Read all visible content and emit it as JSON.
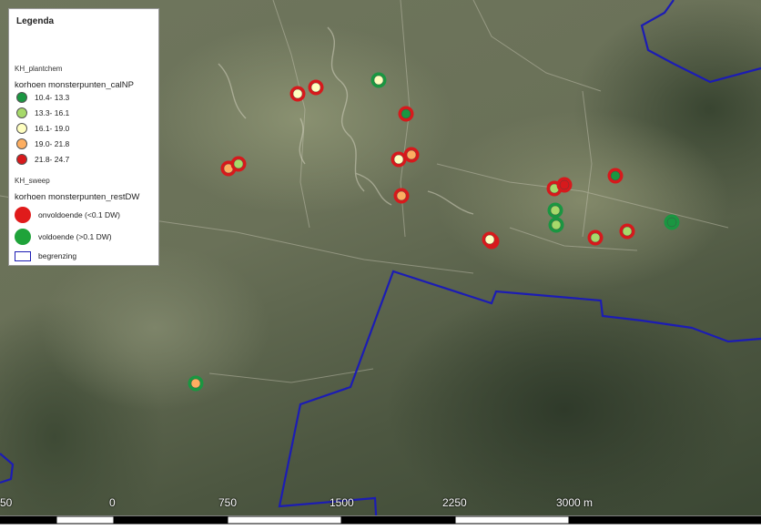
{
  "legend": {
    "title": "Legenda",
    "group_plantchem": "KH_plantchem",
    "layer_calNP": "korhoen monsterpunten_calNP",
    "classes": [
      {
        "label": "10.4- 13.3",
        "color": "#1a9641"
      },
      {
        "label": "13.3- 16.1",
        "color": "#a6d96a"
      },
      {
        "label": "16.1- 19.0",
        "color": "#ffffc0"
      },
      {
        "label": "19.0- 21.8",
        "color": "#fdae61"
      },
      {
        "label": "21.8- 24.7",
        "color": "#d7191c"
      }
    ],
    "group_sweep": "KH_sweep",
    "layer_restDW": "korhoen monsterpunten_restDW",
    "sweep_classes": [
      {
        "label": "onvoldoende (<0.1 DW)",
        "color": "#e01b1b",
        "icon": "red-circle-icon"
      },
      {
        "label": "voldoende (>0.1 DW)",
        "color": "#1fa33a",
        "icon": "green-circle-icon"
      }
    ],
    "boundary": {
      "label": "begrenzing",
      "color": "#1c1cb4",
      "icon": "boundary-box-icon"
    }
  },
  "scale_bar": {
    "labels": [
      "50",
      "0",
      "750",
      "1500",
      "2250",
      "3000 m"
    ]
  },
  "colors": {
    "boundary": "#1c1cb4",
    "ring_red": "#d7191c",
    "ring_green": "#1a9641"
  },
  "sample_points": [
    {
      "id": "p1",
      "calNP_class": 2,
      "restDW": "onvoldoende"
    },
    {
      "id": "p2",
      "calNP_class": 2,
      "restDW": "onvoldoende"
    },
    {
      "id": "p3",
      "calNP_class": 2,
      "restDW": "voldoende"
    },
    {
      "id": "p4",
      "calNP_class": 3,
      "restDW": "onvoldoende"
    },
    {
      "id": "p5",
      "calNP_class": 1,
      "restDW": "onvoldoende"
    },
    {
      "id": "p6",
      "calNP_class": 0,
      "restDW": "onvoldoende"
    },
    {
      "id": "p7",
      "calNP_class": 2,
      "restDW": "onvoldoende"
    },
    {
      "id": "p8",
      "calNP_class": 3,
      "restDW": "onvoldoende"
    },
    {
      "id": "p9",
      "calNP_class": 3,
      "restDW": "onvoldoende"
    },
    {
      "id": "p10",
      "calNP_class": 2,
      "restDW": "onvoldoende"
    },
    {
      "id": "p11",
      "calNP_class": 1,
      "restDW": "onvoldoende"
    },
    {
      "id": "p12",
      "calNP_class": 4,
      "restDW": "onvoldoende"
    },
    {
      "id": "p13",
      "calNP_class": 0,
      "restDW": "onvoldoende"
    },
    {
      "id": "p14",
      "calNP_class": 1,
      "restDW": "voldoende"
    },
    {
      "id": "p15",
      "calNP_class": 1,
      "restDW": "voldoende"
    },
    {
      "id": "p16",
      "calNP_class": 0,
      "restDW": "voldoende"
    },
    {
      "id": "p17",
      "calNP_class": 1,
      "restDW": "onvoldoende"
    },
    {
      "id": "p18",
      "calNP_class": 1,
      "restDW": "onvoldoende"
    },
    {
      "id": "p19",
      "calNP_class": 2,
      "restDW": "onvoldoende"
    },
    {
      "id": "p20",
      "calNP_class": 3,
      "restDW": "voldoende"
    }
  ]
}
